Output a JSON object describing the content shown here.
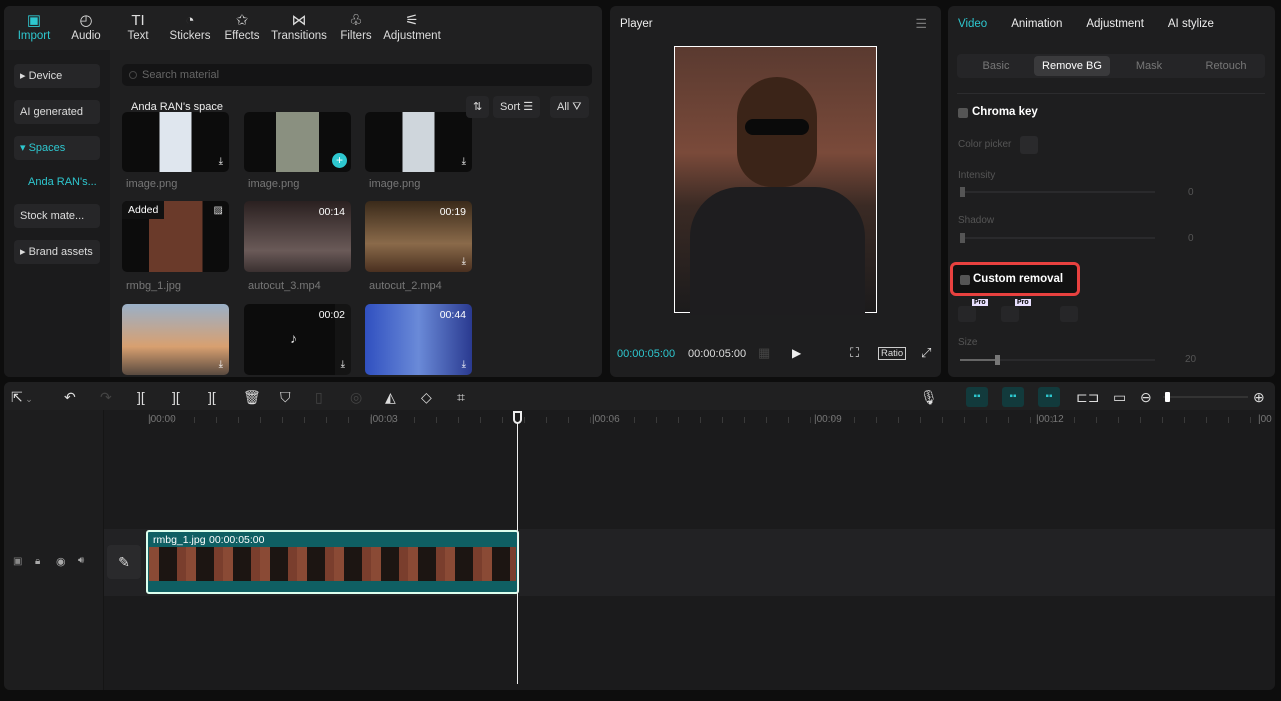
{
  "toolbar": {
    "items": [
      {
        "label": "Import",
        "icon": "import-icon"
      },
      {
        "label": "Audio",
        "icon": "audio-icon"
      },
      {
        "label": "Text",
        "icon": "text-icon"
      },
      {
        "label": "Stickers",
        "icon": "sticker-icon"
      },
      {
        "label": "Effects",
        "icon": "effects-icon"
      },
      {
        "label": "Transitions",
        "icon": "transitions-icon"
      },
      {
        "label": "Filters",
        "icon": "filters-icon"
      },
      {
        "label": "Adjustment",
        "icon": "adjustment-icon"
      }
    ]
  },
  "sidebar": {
    "items": [
      "▸ Device",
      "AI generated",
      "▾ Spaces",
      "Anda RAN's...",
      "Stock mate...",
      "▸ Brand assets"
    ]
  },
  "media": {
    "search_placeholder": "Search material",
    "space_title": "Anda RAN's space",
    "sort_label": "Sort",
    "all_label": "All",
    "items": [
      {
        "name": "image.png"
      },
      {
        "name": "image.png"
      },
      {
        "name": "image.png"
      },
      {
        "name": "rmbg_1.jpg",
        "badge": "Added"
      },
      {
        "name": "autocut_3.mp4",
        "duration": "00:14"
      },
      {
        "name": "autocut_2.mp4",
        "duration": "00:19"
      },
      {
        "name": ""
      },
      {
        "name": "",
        "duration": "00:02"
      },
      {
        "name": "",
        "duration": "00:44"
      }
    ]
  },
  "player": {
    "title": "Player",
    "current_time": "00:00:05:00",
    "total_time": "00:00:05:00",
    "ratio_label": "Ratio"
  },
  "inspector": {
    "tabs": [
      "Video",
      "Animation",
      "Adjustment",
      "AI stylize"
    ],
    "subtabs": [
      "Basic",
      "Remove BG",
      "Mask",
      "Retouch"
    ],
    "active_subtab": "Remove BG",
    "chroma_key": "Chroma key",
    "color_picker": "Color picker",
    "intensity": "Intensity",
    "intensity_value": "0",
    "shadow": "Shadow",
    "shadow_value": "0",
    "custom_removal": "Custom removal",
    "pro_badge": "Pro",
    "size": "Size",
    "size_value": "20"
  },
  "timeline": {
    "ticks": [
      "00:00",
      "00:03",
      "00:06",
      "00:09",
      "00:12",
      "00"
    ],
    "clip": {
      "name": "rmbg_1.jpg",
      "duration": "00:00:05:00"
    }
  },
  "colors": {
    "accent": "#2ec7cf",
    "highlight": "#e8413f",
    "clip": "#0f5f63"
  }
}
